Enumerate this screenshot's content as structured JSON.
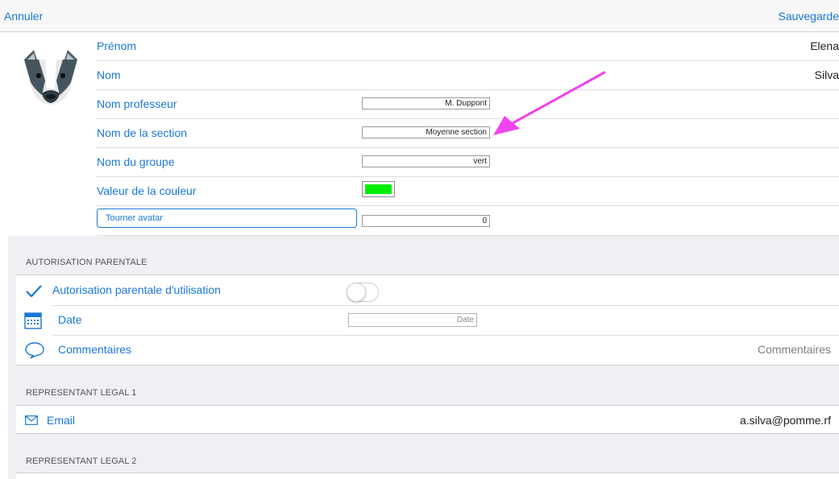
{
  "toolbar": {
    "cancel_label": "Annuler",
    "save_label": "Sauvegarde"
  },
  "profile": {
    "first_name_label": "Prénom",
    "first_name_value": "Elena",
    "last_name_label": "Nom",
    "last_name_value": "Silva",
    "teacher_label": "Nom professeur",
    "teacher_value": "M. Duppont",
    "section_label": "Nom de la section",
    "section_value": "Moyenne section",
    "group_label": "Nom du groupe",
    "group_value": "vert",
    "color_label": "Valeur de la couleur",
    "color_value": "#00ee00",
    "rotate_button_label": "Tourner avatar",
    "rotate_value": "0"
  },
  "parental": {
    "header": "AUTORISATION PARENTALE",
    "authorization_label": "Autorisation parentale d'utilisation",
    "authorization_on": false,
    "date_label": "Date",
    "date_placeholder": "Date",
    "comments_label": "Commentaires",
    "comments_placeholder": "Commentaires"
  },
  "legal1": {
    "header": "REPRESENTANT LEGAL 1",
    "email_label": "Email",
    "email_value": "a.silva@pomme.rf"
  },
  "legal2": {
    "header": "REPRESENTANT LEGAL 2"
  },
  "colors": {
    "accent": "#1a78d6",
    "annotation": "#ee44ee",
    "group": "#00ee00"
  },
  "icons": [
    "badger-avatar-icon",
    "checkmark-icon",
    "calendar-icon",
    "speech-bubble-icon",
    "envelope-icon"
  ]
}
